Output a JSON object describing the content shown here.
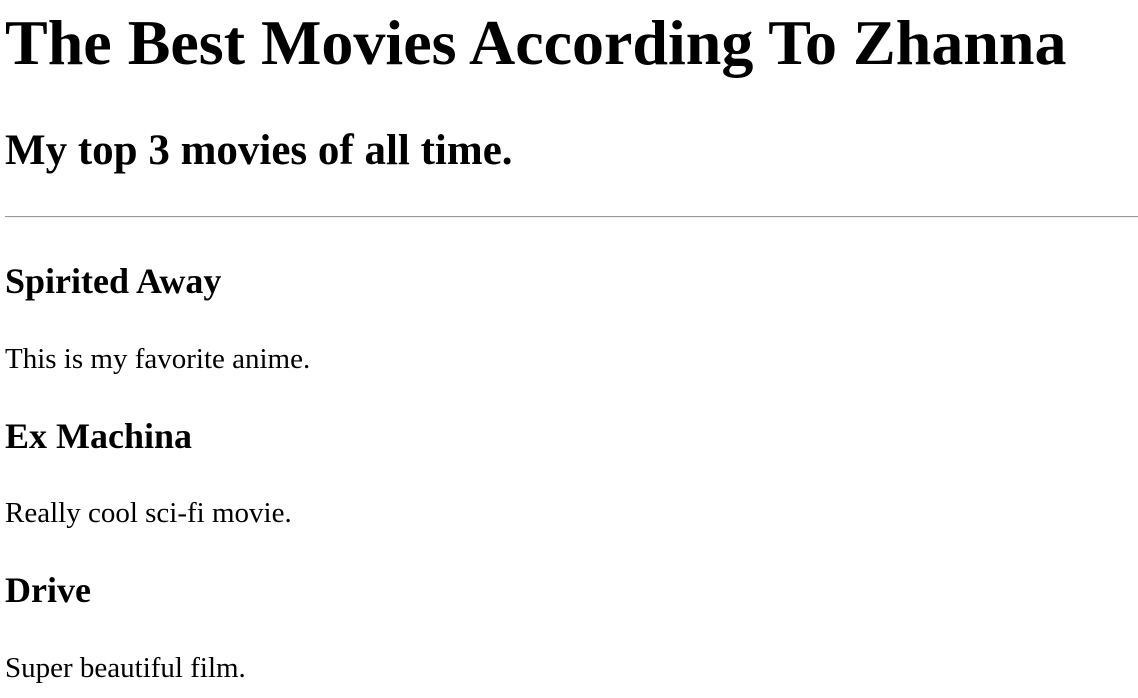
{
  "header": {
    "title": "The Best Movies According To Zhanna",
    "subtitle": "My top 3 movies of all time."
  },
  "movies": [
    {
      "title": "Spirited Away",
      "description": "This is my favorite anime."
    },
    {
      "title": "Ex Machina",
      "description": "Really cool sci-fi movie."
    },
    {
      "title": "Drive",
      "description": "Super beautiful film."
    }
  ]
}
